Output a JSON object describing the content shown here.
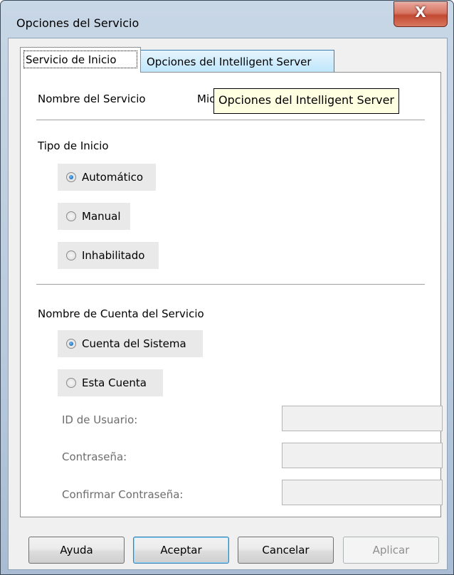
{
  "window": {
    "title": "Opciones del Servicio",
    "close_glyph": "X"
  },
  "tabs": [
    {
      "label": "Servicio de Inicio",
      "active": true
    },
    {
      "label": "Opciones del Intelligent Server",
      "active": false
    }
  ],
  "service_name": {
    "label": "Nombre del Servicio",
    "value_partial": "Micr"
  },
  "tooltip": {
    "text": "Opciones del Intelligent Server"
  },
  "startup_type": {
    "heading": "Tipo de Inicio",
    "options": [
      {
        "label": "Automático",
        "checked": true
      },
      {
        "label": "Manual",
        "checked": false
      },
      {
        "label": "Inhabilitado",
        "checked": false
      }
    ]
  },
  "account": {
    "heading": "Nombre de Cuenta del Servicio",
    "options": [
      {
        "label": "Cuenta del Sistema",
        "checked": true
      },
      {
        "label": "Esta Cuenta",
        "checked": false
      }
    ],
    "fields": [
      {
        "label": "ID de Usuario:",
        "value": ""
      },
      {
        "label": "Contraseña:",
        "value": ""
      },
      {
        "label": "Confirmar Contraseña:",
        "value": ""
      }
    ]
  },
  "buttons": {
    "help": "Ayuda",
    "ok": "Aceptar",
    "cancel": "Cancelar",
    "apply": "Aplicar"
  }
}
